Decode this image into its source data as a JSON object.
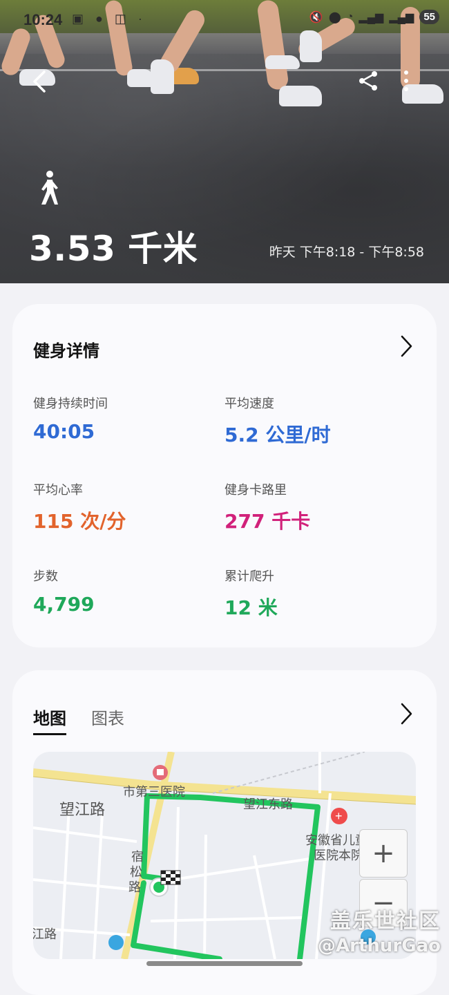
{
  "status_bar": {
    "time": "10:24",
    "battery": "55"
  },
  "header": {
    "distance": "3.53 千米",
    "time_range": "昨天 下午8:18 - 下午8:58"
  },
  "fitness_details": {
    "title": "健身详情",
    "stats": [
      {
        "label": "健身持续时间",
        "value": "40:05",
        "color": "#2f6ad4"
      },
      {
        "label": "平均速度",
        "value": "5.2 公里/时",
        "color": "#2f6ad4"
      },
      {
        "label": "平均心率",
        "value": "115 次/分",
        "color": "#e2632c"
      },
      {
        "label": "健身卡路里",
        "value": "277 千卡",
        "color": "#d1217a"
      },
      {
        "label": "步数",
        "value": "4,799",
        "color": "#1fa85a"
      },
      {
        "label": "累计爬升",
        "value": "12 米",
        "color": "#1fa85a"
      }
    ]
  },
  "map_section": {
    "tabs": [
      {
        "label": "地图",
        "active": true
      },
      {
        "label": "图表",
        "active": false
      }
    ],
    "map_labels": {
      "road_left": "望江路",
      "hospital_top": "市第三医院",
      "road_right": "望江东路",
      "children_hospital_1": "安徽省儿童",
      "children_hospital_2": "医院本院",
      "vertical_road_1": "宿",
      "vertical_road_2": "松",
      "vertical_road_3": "路",
      "road_bottom": "江路"
    },
    "route_color": "#22c55e"
  },
  "watermark": {
    "line1": "盖乐世社区",
    "line2": "@ArthurGao"
  }
}
